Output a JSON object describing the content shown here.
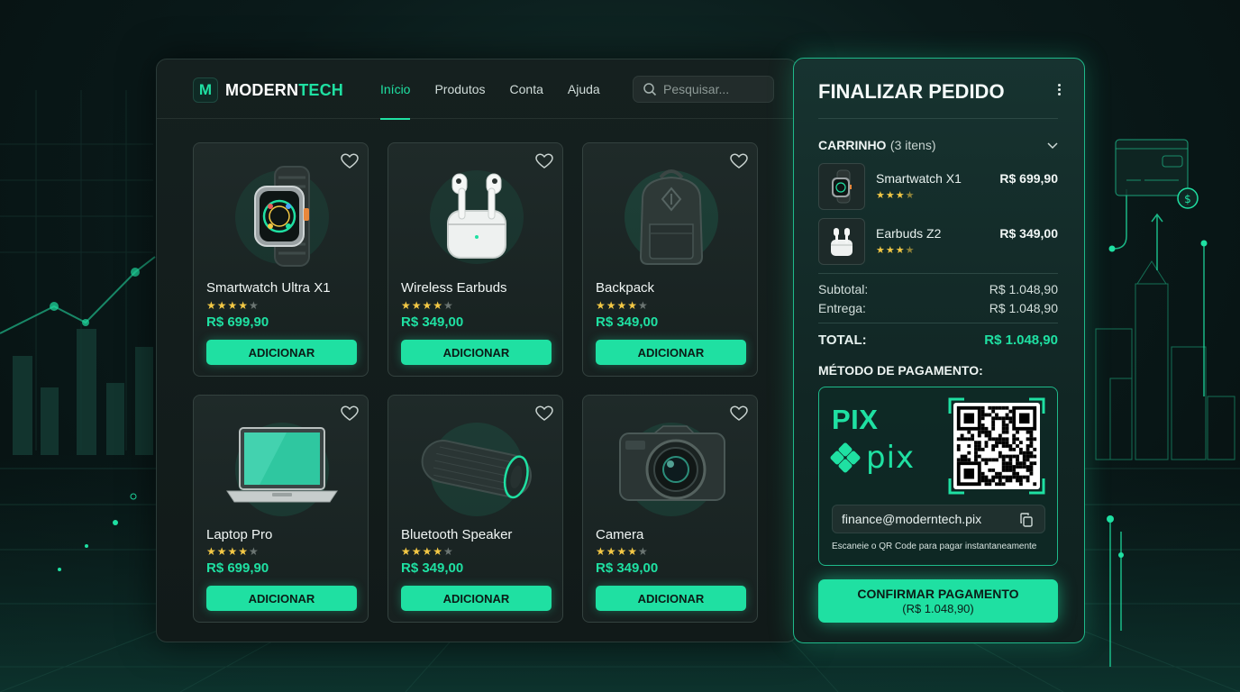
{
  "brand": {
    "name_part1": "MODERN",
    "name_part2": "TECH",
    "logo_letter": "M"
  },
  "nav": {
    "items": [
      {
        "label": "Início",
        "active": true
      },
      {
        "label": "Produtos",
        "active": false
      },
      {
        "label": "Conta",
        "active": false
      },
      {
        "label": "Ajuda",
        "active": false
      }
    ],
    "search_placeholder": "Pesquisar..."
  },
  "products": [
    {
      "name": "Smartwatch Ultra X1",
      "rating": 4,
      "price": "R$ 699,90",
      "button": "ADICIONAR",
      "icon": "smartwatch-icon"
    },
    {
      "name": "Wireless Earbuds",
      "rating": 4,
      "price": "R$ 349,00",
      "button": "ADICIONAR",
      "icon": "earbuds-icon"
    },
    {
      "name": "Backpack",
      "rating": 4,
      "price": "R$ 349,00",
      "button": "ADICIONAR",
      "icon": "backpack-icon"
    },
    {
      "name": "Laptop Pro",
      "rating": 4,
      "price": "R$ 699,90",
      "button": "ADICIONAR",
      "icon": "laptop-icon"
    },
    {
      "name": "Bluetooth Speaker",
      "rating": 4,
      "price": "R$ 349,00",
      "button": "ADICIONAR",
      "icon": "speaker-icon"
    },
    {
      "name": "Camera",
      "rating": 4,
      "price": "R$ 349,00",
      "button": "ADICIONAR",
      "icon": "camera-icon"
    }
  ],
  "checkout": {
    "title": "FINALIZAR PEDIDO",
    "cart_label": "CARRINHO",
    "cart_count": "(3 itens)",
    "items": [
      {
        "name": "Smartwatch X1",
        "rating": 3.5,
        "price": "R$ 699,90"
      },
      {
        "name": "Earbuds Z2",
        "rating": 3.5,
        "price": "R$ 349,00"
      }
    ],
    "subtotal_label": "Subtotal:",
    "subtotal_value": "R$ 1.048,90",
    "shipping_label": "Entrega:",
    "shipping_value": "R$ 1.048,90",
    "total_label": "TOTAL:",
    "total_value": "R$ 1.048,90",
    "payment_label": "MÉTODO DE PAGAMENTO:",
    "pix_title": "PIX",
    "pix_logo_text": "pix",
    "pix_key": "finance@moderntech.pix",
    "pix_hint": "Escaneie o QR Code para pagar instantaneamente",
    "confirm_line1": "CONFIRMAR PAGAMENTO",
    "confirm_line2": "(R$ 1.048,90)"
  },
  "colors": {
    "accent": "#1fe0a2",
    "star": "#f3c845",
    "background": "#0a1a1a"
  }
}
